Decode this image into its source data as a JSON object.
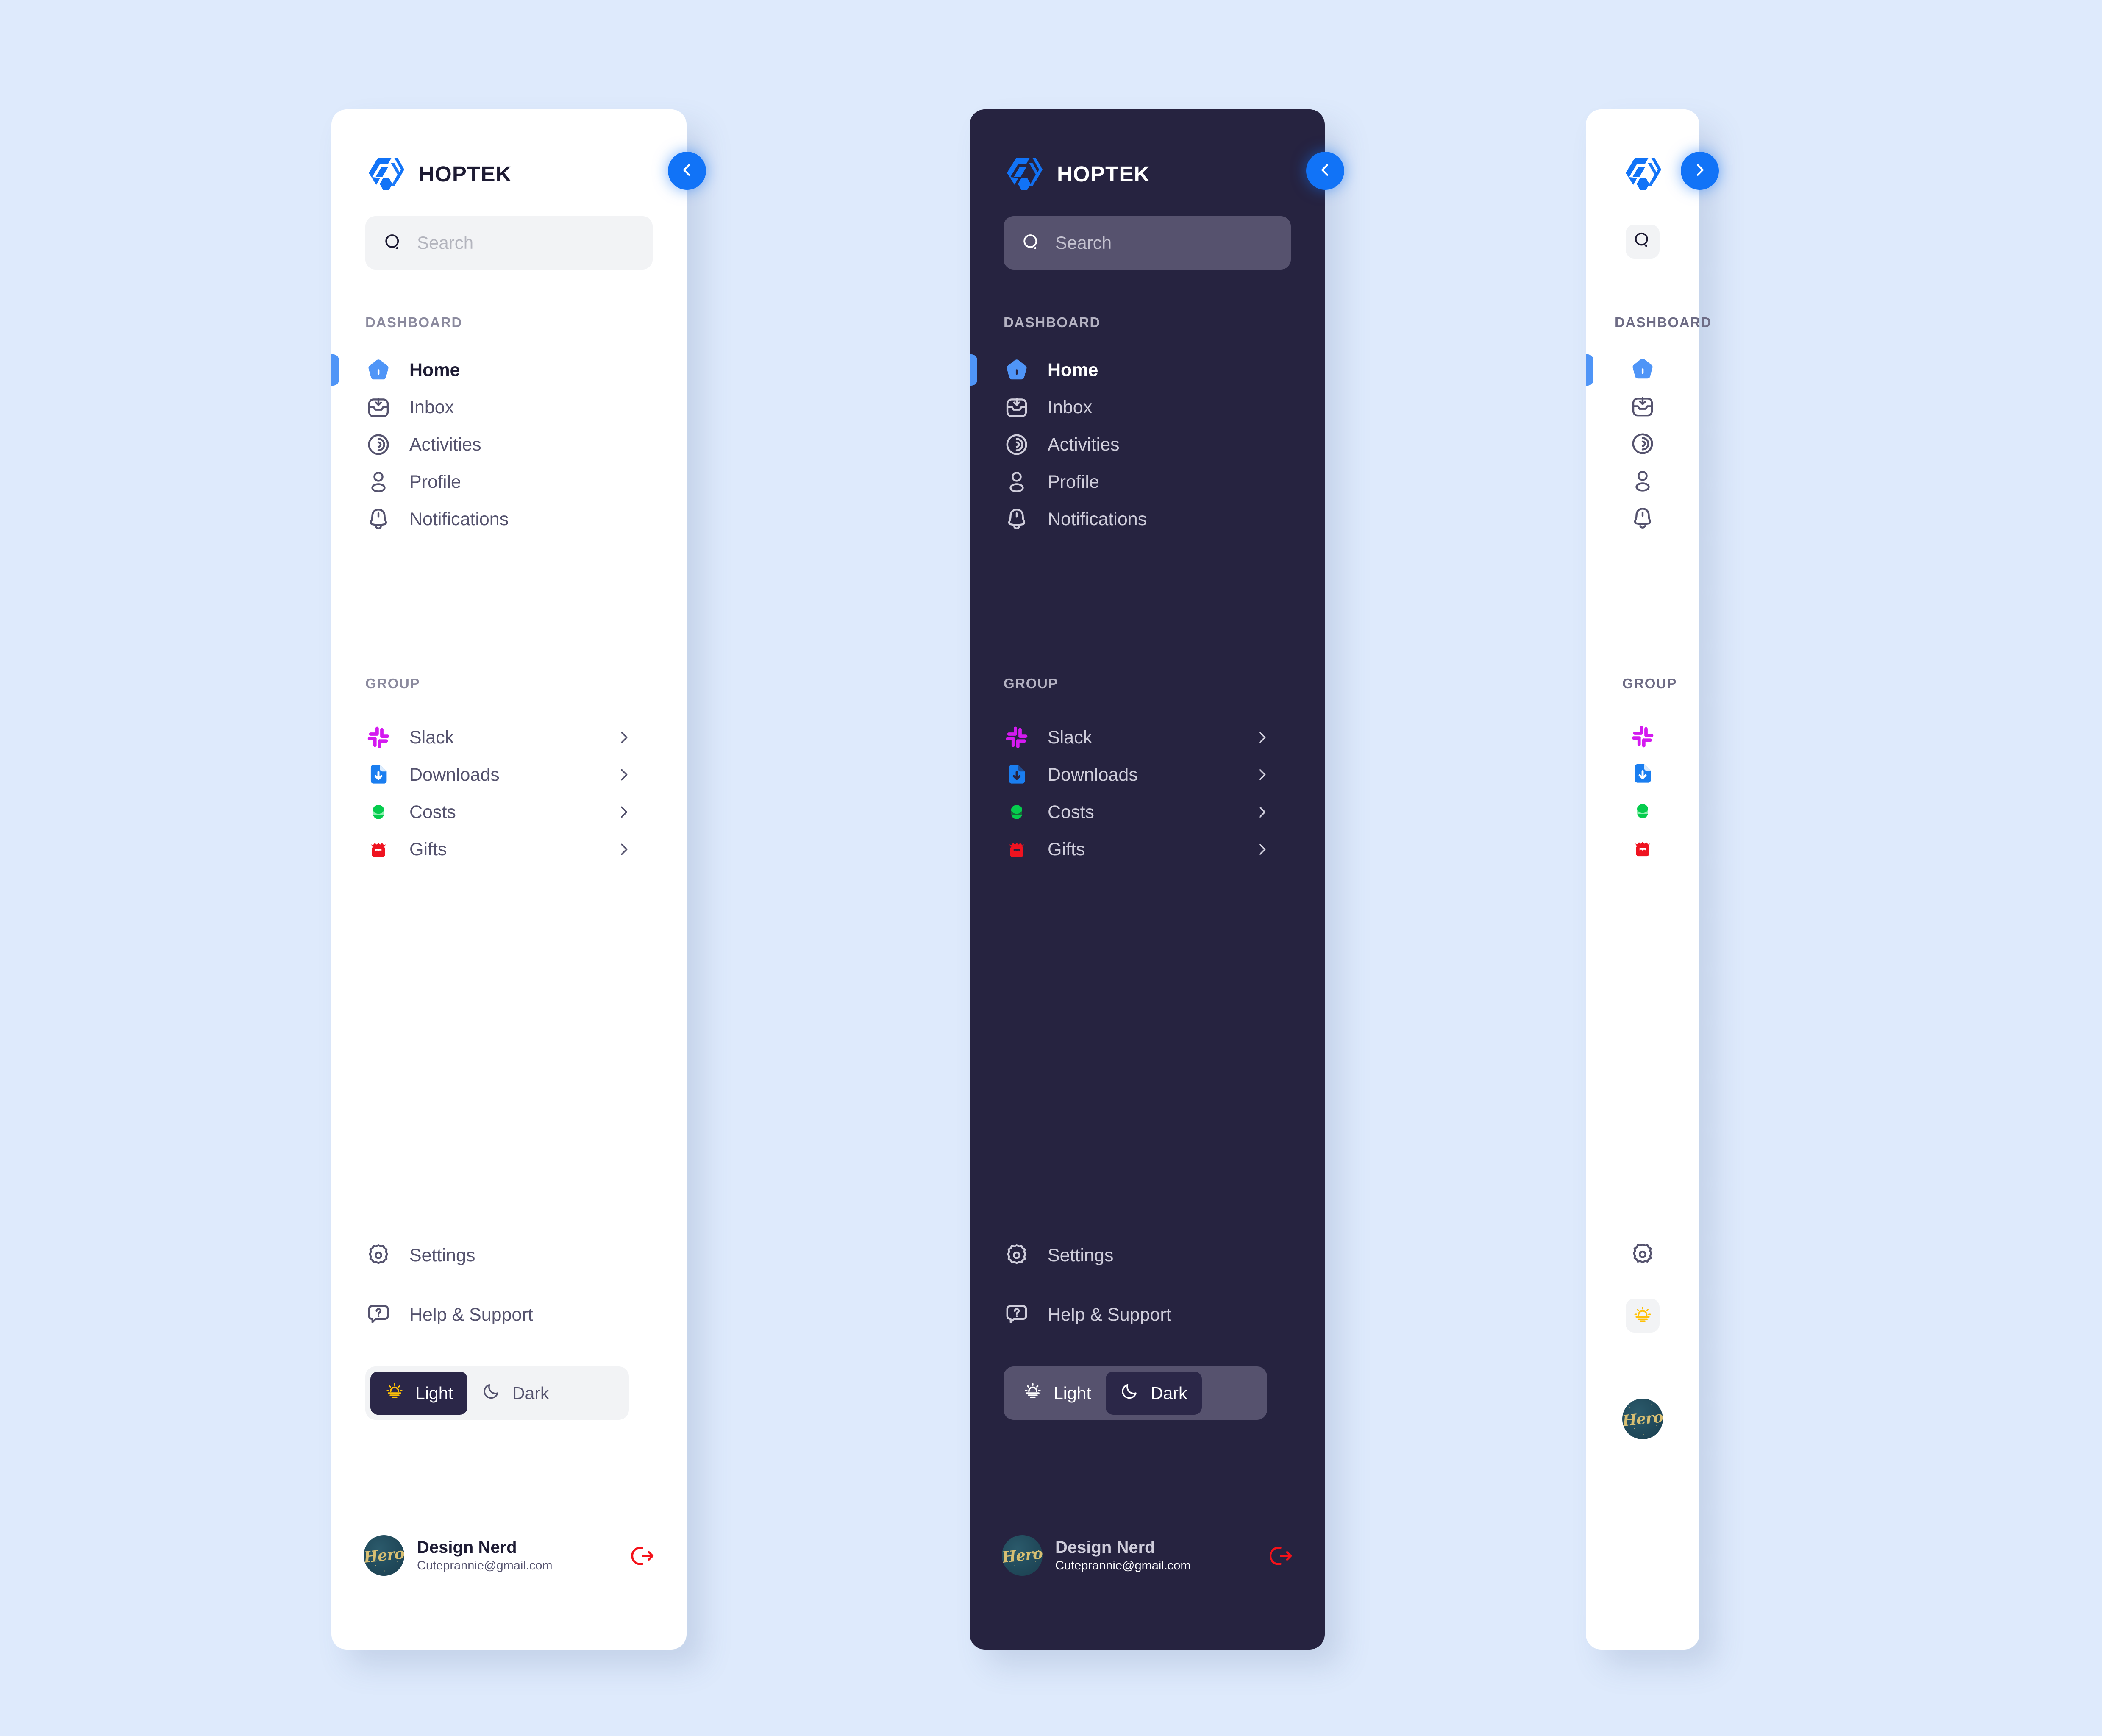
{
  "app": {
    "brand_name": "HOPTEK",
    "accent_color": "#1173f7",
    "background_color": "#deeafc",
    "panel_light_bg": "#ffffff",
    "panel_dark_bg": "#262340"
  },
  "search": {
    "placeholder": "Search",
    "icon": "search-icon"
  },
  "sections": {
    "dashboard_label": "DASHBOARD",
    "group_label": "GROUP"
  },
  "dashboard_items": [
    {
      "label": "Home",
      "icon": "home-icon",
      "active": true,
      "color": "#4f95f7"
    },
    {
      "label": "Inbox",
      "icon": "inbox-icon",
      "active": false,
      "color": "#55536e"
    },
    {
      "label": "Activities",
      "icon": "activity-icon",
      "active": false,
      "color": "#55536e"
    },
    {
      "label": "Profile",
      "icon": "user-icon",
      "active": false,
      "color": "#55536e"
    },
    {
      "label": "Notifications",
      "icon": "bell-icon",
      "active": false,
      "color": "#55536e"
    }
  ],
  "group_items": [
    {
      "label": "Slack",
      "icon": "slack-icon",
      "color": "#d41af0",
      "chevron": "chevron-right-icon"
    },
    {
      "label": "Downloads",
      "icon": "download-icon",
      "color": "#1a7ef0",
      "chevron": "chevron-right-icon"
    },
    {
      "label": "Costs",
      "icon": "coins-icon",
      "color": "#05cc4d",
      "chevron": "chevron-right-icon"
    },
    {
      "label": "Gifts",
      "icon": "gift-icon",
      "color": "#ef1320",
      "chevron": "chevron-right-icon"
    }
  ],
  "footer_items": [
    {
      "label": "Settings",
      "icon": "gear-icon"
    },
    {
      "label": "Help & Support",
      "icon": "help-icon"
    }
  ],
  "theme_toggle": {
    "light_label": "Light",
    "dark_label": "Dark",
    "light_icon": "sunrise-icon",
    "dark_icon": "moon-icon",
    "light_panel_selected": "Light",
    "dark_panel_selected": "Dark",
    "active_pill_color": "#2b2748"
  },
  "user": {
    "name": "Design Nerd",
    "email": "Cuteprannie@gmail.com",
    "avatar_text": "Hero",
    "logout_icon": "logout-icon",
    "logout_color": "#f4121a"
  },
  "collapse_buttons": {
    "light_icon": "chevron-left-icon",
    "dark_icon": "chevron-left-icon",
    "rail_icon": "chevron-right-icon"
  }
}
